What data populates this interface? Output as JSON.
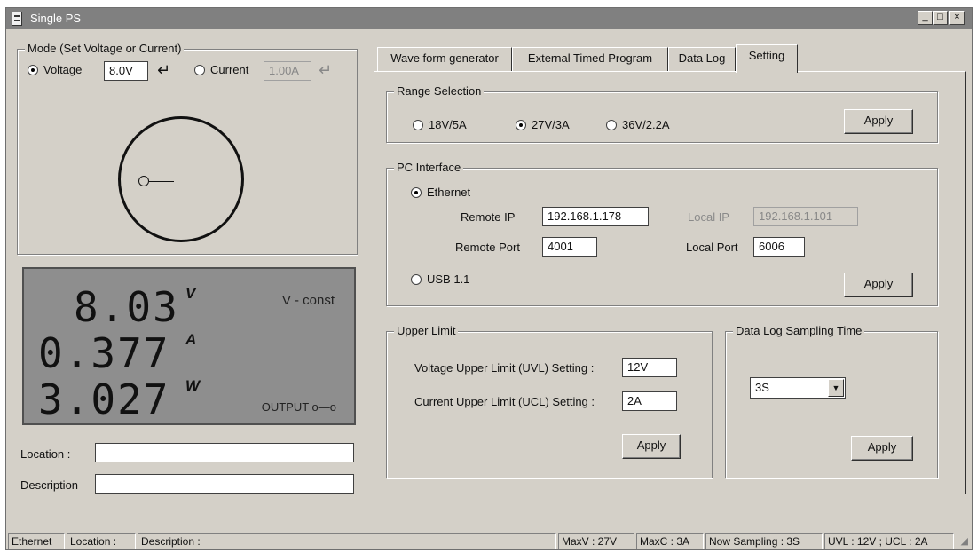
{
  "window": {
    "title": "Single PS",
    "controls": {
      "minimize": "_",
      "maximize": "□",
      "close": "×"
    }
  },
  "mode": {
    "legend": "Mode (Set Voltage or Current)",
    "voltage_label": "Voltage",
    "voltage_value": "8.0V",
    "voltage_selected": true,
    "current_label": "Current",
    "current_value": "1.00A",
    "enter_icon": "enter-arrow-icon"
  },
  "display": {
    "voltage": "8.03",
    "voltage_unit": "V",
    "current": "0.377",
    "current_unit": "A",
    "power": "3.027",
    "power_unit": "W",
    "status": "V - const",
    "output": "OUTPUT o—o"
  },
  "location": {
    "label": "Location :",
    "value": ""
  },
  "description": {
    "label": "Description",
    "value": ""
  },
  "tabs": [
    {
      "label": "Wave form generator",
      "active": false
    },
    {
      "label": "External Timed Program",
      "active": false
    },
    {
      "label": "Data Log",
      "active": false
    },
    {
      "label": "Setting",
      "active": true
    }
  ],
  "range": {
    "legend": "Range Selection",
    "options": [
      {
        "label": "18V/5A",
        "selected": false
      },
      {
        "label": "27V/3A",
        "selected": true
      },
      {
        "label": "36V/2.2A",
        "selected": false
      }
    ],
    "apply": "Apply"
  },
  "pc_interface": {
    "legend": "PC Interface",
    "ethernet_label": "Ethernet",
    "remote_ip_label": "Remote IP",
    "remote_ip": "192.168.1.178",
    "remote_port_label": "Remote Port",
    "remote_port": "4001",
    "local_ip_label": "Local IP",
    "local_ip": "192.168.1.101",
    "local_port_label": "Local Port",
    "local_port": "6006",
    "usb_label": "USB 1.1",
    "apply": "Apply"
  },
  "upper_limit": {
    "legend": "Upper Limit",
    "uvl_label": "Voltage Upper Limit (UVL) Setting :",
    "uvl_value": "12V",
    "ucl_label": "Current Upper Limit (UCL) Setting :",
    "ucl_value": "2A",
    "apply": "Apply"
  },
  "sampling": {
    "legend": "Data Log Sampling Time",
    "value": "3S",
    "apply": "Apply"
  },
  "statusbar": {
    "interface": "Ethernet",
    "location": "Location :",
    "description": "Description :",
    "maxv": "MaxV : 27V",
    "maxc": "MaxC : 3A",
    "sampling": "Now Sampling : 3S",
    "limits": "UVL : 12V ; UCL : 2A"
  }
}
